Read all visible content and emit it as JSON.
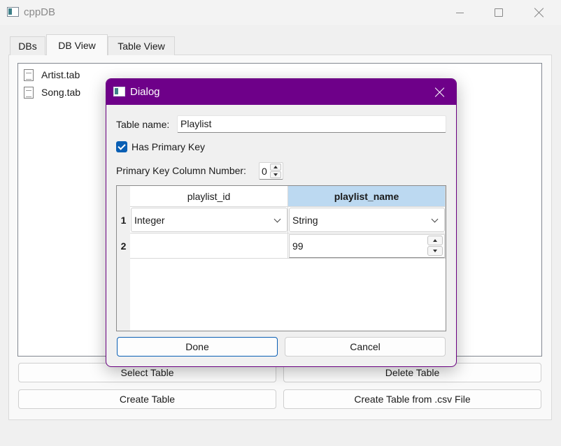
{
  "window": {
    "title": "cppDB",
    "icon": "app-window-icon"
  },
  "tabs": [
    {
      "label": "DBs",
      "active": false
    },
    {
      "label": "DB View",
      "active": true
    },
    {
      "label": "Table View",
      "active": false
    }
  ],
  "file_list": [
    {
      "name": "Artist.tab",
      "icon": "document-icon"
    },
    {
      "name": "Song.tab",
      "icon": "document-icon"
    }
  ],
  "buttons": {
    "select_table": "Select Table",
    "delete_table": "Delete Table",
    "create_table": "Create Table",
    "create_from_csv": "Create Table from .csv File"
  },
  "dialog": {
    "title": "Dialog",
    "table_name_label": "Table name:",
    "table_name_value": "Playlist",
    "has_primary_key_label": "Has Primary Key",
    "has_primary_key_checked": true,
    "pk_column_label": "Primary Key Column Number:",
    "pk_column_value": "0",
    "columns": [
      "playlist_id",
      "playlist_name"
    ],
    "row_headers": [
      "1",
      "2"
    ],
    "rows": {
      "type_row": [
        "Integer",
        "String"
      ],
      "size_row": [
        "",
        "99"
      ]
    },
    "done_label": "Done",
    "cancel_label": "Cancel",
    "accent_color": "#6e0089"
  }
}
